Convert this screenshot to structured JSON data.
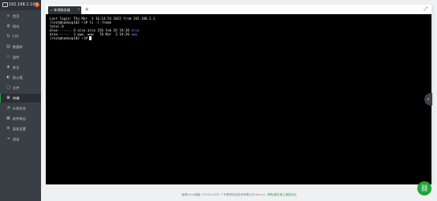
{
  "header": {
    "ip": "192.168.2.102",
    "badge": "0"
  },
  "sidebar": {
    "items": [
      {
        "label": "首页",
        "icon": "home-icon",
        "glyph": "⌂"
      },
      {
        "label": "网站",
        "icon": "globe-icon",
        "glyph": "◍"
      },
      {
        "label": "FTP",
        "icon": "ftp-icon",
        "glyph": "⇅"
      },
      {
        "label": "数据库",
        "icon": "database-icon",
        "glyph": "▤"
      },
      {
        "label": "监控",
        "icon": "monitor-icon",
        "glyph": "▭"
      },
      {
        "label": "安全",
        "icon": "shield-icon",
        "glyph": "◈"
      },
      {
        "label": "防火墙",
        "icon": "firewall-icon",
        "glyph": "◐"
      },
      {
        "label": "文件",
        "icon": "folder-icon",
        "glyph": "▢"
      },
      {
        "label": "终端",
        "icon": "terminal-icon",
        "glyph": "▣",
        "active": true
      },
      {
        "label": "计划任务",
        "icon": "clock-icon",
        "glyph": "◔"
      },
      {
        "label": "软件商店",
        "icon": "store-icon",
        "glyph": "▦"
      },
      {
        "label": "面板设置",
        "icon": "settings-icon",
        "glyph": "⚙"
      },
      {
        "label": "退出",
        "icon": "logout-icon",
        "glyph": "⇥"
      }
    ]
  },
  "terminal_tab": {
    "label": "本地服务器",
    "close": "×"
  },
  "tab_add": "+",
  "fullscreen": "⤢",
  "terminal": {
    "lines": [
      {
        "text": "Last login: Thu Mar  3 16:14:54 2022 from 192.168.2.1"
      },
      {
        "text": "[root@hadoop102 ~]# ls -l /home"
      },
      {
        "text": "total 0"
      },
      {
        "text": "drwx------. 6 also also 156 Feb 26 19:30 ",
        "blue": "also"
      },
      {
        "text": "drwx------  3 www  www   78 Mar  3 19:20 ",
        "blue": "www"
      },
      {
        "text": "[root@hadoop102 ~]# ",
        "cursor": true
      }
    ]
  },
  "edge_toggle": "‹",
  "footer": {
    "copyright": "宝塔Linux面板 ©2014-2022 广东堡塔安全技术有限公司 (bt.cn)",
    "link": "求助|建议请上宝塔论坛"
  },
  "help": {
    "line1": "客服",
    "line2": "客服"
  }
}
